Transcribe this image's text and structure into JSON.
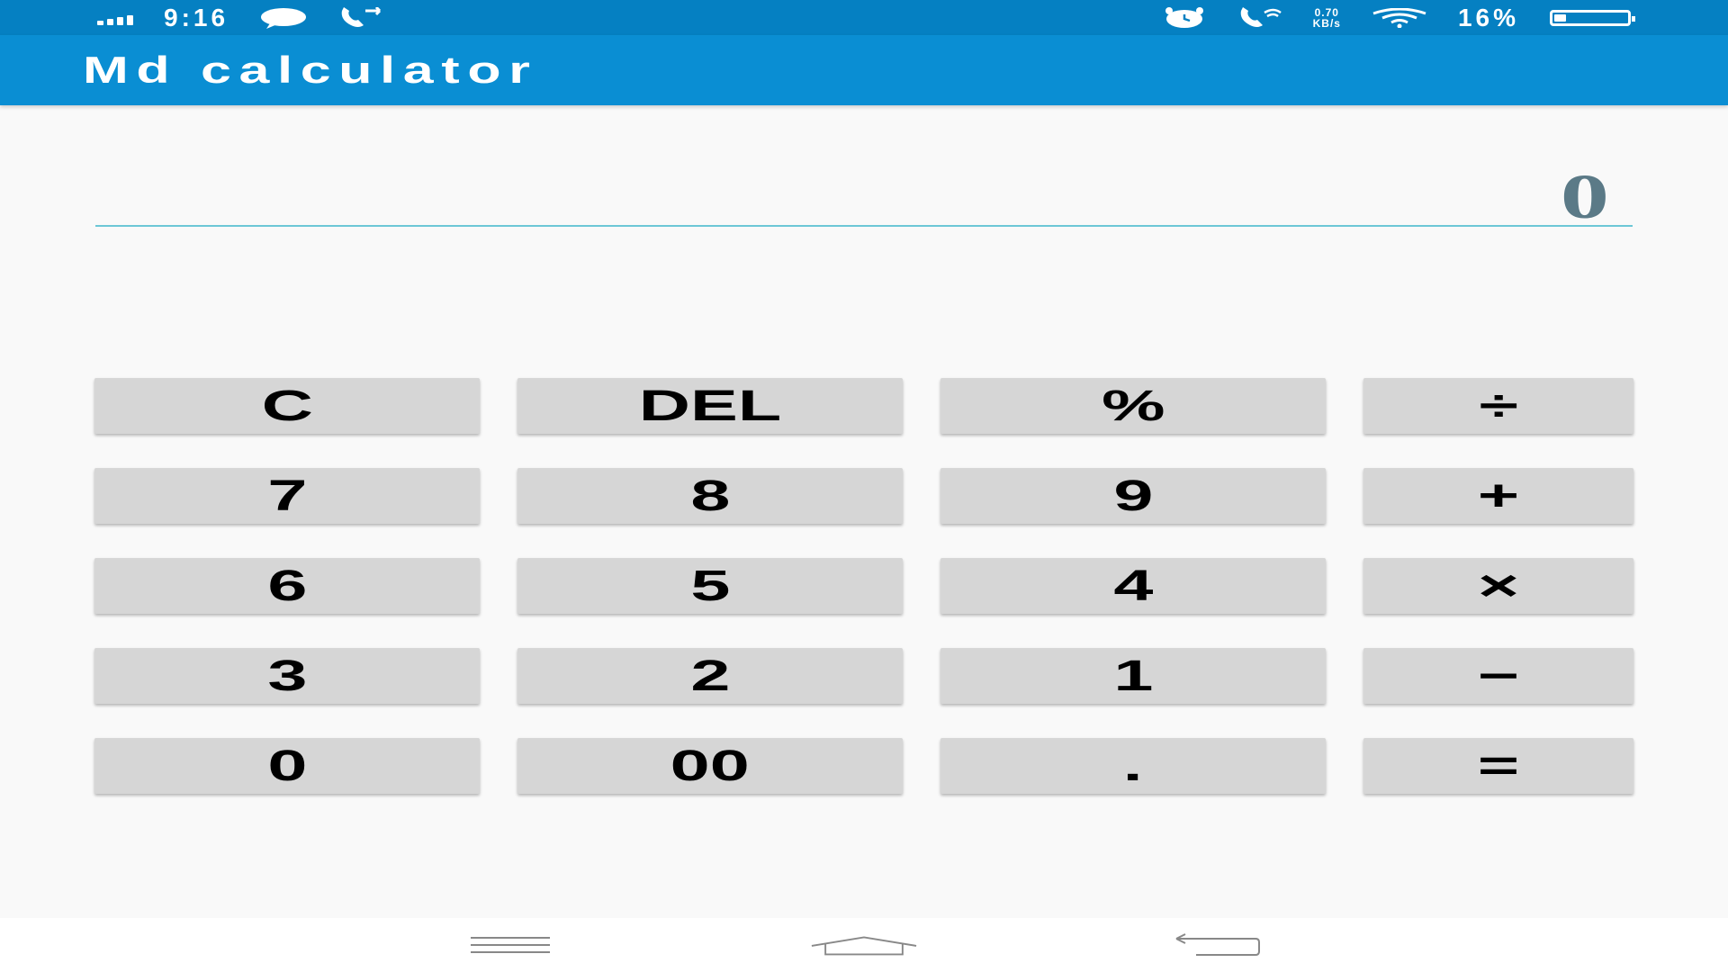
{
  "statusbar": {
    "time": "9:16",
    "network_speed_value": "0.70",
    "network_speed_unit": "KB/s",
    "battery": "16%",
    "battery_level": 0.16,
    "icons": [
      "signal-icon",
      "message-icon",
      "call-icon",
      "alarm-icon",
      "wifi-calling-icon",
      "wifi-icon",
      "battery-icon"
    ]
  },
  "appbar": {
    "title": "Md calculator",
    "color": "#0a8ed3"
  },
  "display": {
    "value": "0",
    "underline_color": "#6cc7d6"
  },
  "keypad": {
    "rows": [
      [
        "C",
        "DEL",
        "%",
        "÷"
      ],
      [
        "7",
        "8",
        "9",
        "+"
      ],
      [
        "6",
        "5",
        "4",
        "×"
      ],
      [
        "3",
        "2",
        "1",
        "−"
      ],
      [
        "0",
        "00",
        ".",
        "="
      ]
    ],
    "key_color": "#d6d6d6"
  },
  "navbar": {
    "icons": [
      "menu-icon",
      "home-icon",
      "back-icon"
    ]
  }
}
